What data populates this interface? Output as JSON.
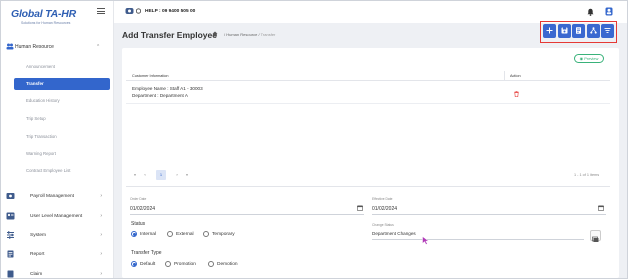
{
  "app": {
    "logo_text": "Global TA-HR",
    "logo_tagline": "Solutions for Human Resources"
  },
  "sidebar": {
    "group_label": "Human Resource",
    "sub_items": [
      "Announcement",
      "Transfer",
      "Education History",
      "Trip Setup",
      "Trip Transaction",
      "Warning Report",
      "Contract Employee List"
    ],
    "active_sub": "Transfer",
    "main_items": [
      {
        "label": "Payroll Management",
        "icon": "payroll-icon"
      },
      {
        "label": "User Level Management",
        "icon": "user-level-icon"
      },
      {
        "label": "System",
        "icon": "system-icon"
      },
      {
        "label": "Report",
        "icon": "report-icon"
      },
      {
        "label": "Claim",
        "icon": "claim-icon"
      }
    ]
  },
  "topbar": {
    "help_text": "HELP : 09 9400 505 00"
  },
  "header": {
    "title": "Add Transfer Employee",
    "breadcrumb": [
      "Human Resource",
      "Transfer"
    ],
    "toolbar_icons": [
      "add-icon",
      "save-icon",
      "document-icon",
      "workflow-icon",
      "filter-icon"
    ]
  },
  "preview_label": "Preview",
  "table": {
    "columns": [
      "Customer Information",
      "Action"
    ],
    "rows": [
      {
        "line1": "Employee Name : Staff A1 - 30003",
        "line2": "Department : Department A"
      }
    ]
  },
  "pager": {
    "page": "1",
    "summary": "1 - 1 of 1 items"
  },
  "form": {
    "order_date": {
      "label": "Order Date",
      "value": "01/02/2024"
    },
    "effective_date": {
      "label": "Effective Date",
      "value": "01/02/2024"
    },
    "status": {
      "label": "Status",
      "options": [
        "Internal",
        "External",
        "Temporary"
      ],
      "selected": "Internal"
    },
    "change_status": {
      "label": "Change Status",
      "value": "Department Changes"
    },
    "transfer_type": {
      "label": "Transfer Type",
      "options": [
        "Default",
        "Promotion",
        "Demotion"
      ],
      "selected": "Default"
    }
  },
  "colors": {
    "primary": "#3366cc",
    "highlight_box": "#e53935",
    "preview": "#39b27a",
    "delete": "#e53935"
  }
}
